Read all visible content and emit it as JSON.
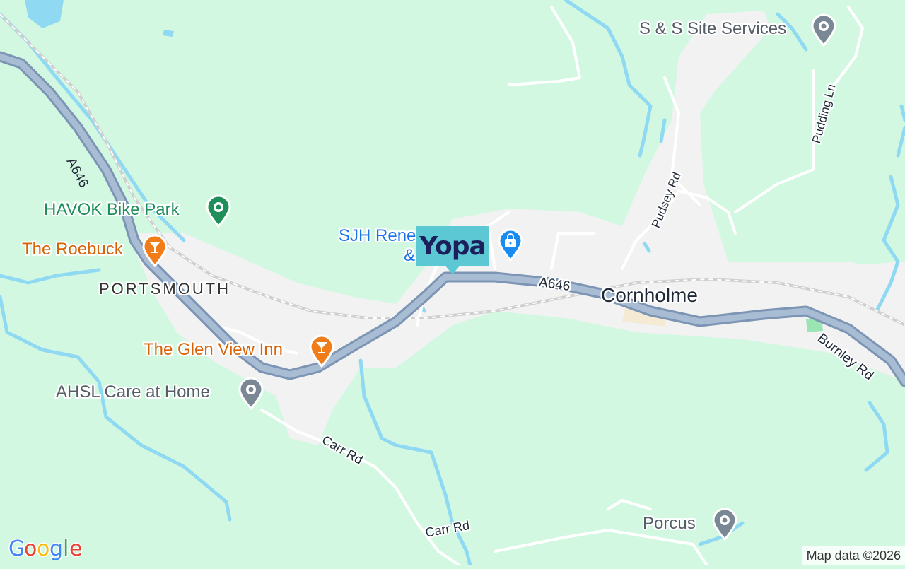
{
  "map": {
    "place": "Cornholme",
    "district": "PORTSMOUTH",
    "roads": {
      "a646_upper": "A646",
      "a646_mid": "A646",
      "burnley_rd": "Burnley Rd",
      "pudsey_rd": "Pudsey Rd",
      "pudding_ln": "Pudding Ln",
      "carr_rd_1": "Carr Rd",
      "carr_rd_2": "Carr Rd"
    },
    "pois": [
      {
        "name": "S & S Site Services",
        "icon": "generic-pin-icon",
        "color": "#6b7a8a"
      },
      {
        "name": "HAVOK Bike Park",
        "icon": "park-pin-icon",
        "color": "#1e8e5a"
      },
      {
        "name": "The Roebuck",
        "icon": "cocktail-pin-icon",
        "color": "#e8710a"
      },
      {
        "name": "The Glen View Inn",
        "icon": "cocktail-pin-icon",
        "color": "#e8710a"
      },
      {
        "name": "AHSL Care at Home",
        "icon": "generic-pin-icon",
        "color": "#6b7a8a"
      },
      {
        "name": "SJH Rene",
        "name_line2": "&",
        "icon": "shopping-bag-pin-icon",
        "color": "#1a73e8"
      },
      {
        "name": "Porcus",
        "icon": "generic-pin-icon",
        "color": "#6b7a8a"
      }
    ],
    "marker": {
      "label": "Yopa",
      "color": "#5cc8d4"
    },
    "colors": {
      "land": "#d3f8e2",
      "water": "#8fd9f3",
      "main_road": "#8aa3bf",
      "urban": "#f2f2f2"
    }
  },
  "branding": {
    "logo": "Google"
  },
  "attribution": "Map data ©2026"
}
